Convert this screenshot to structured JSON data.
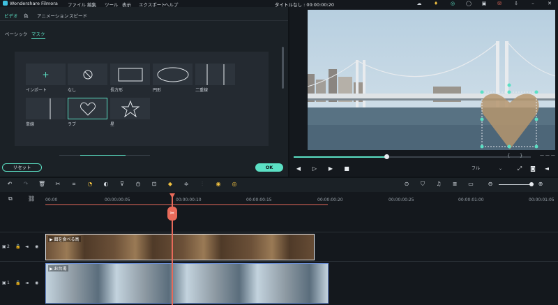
{
  "titlebar": {
    "app_name": "Wondershare Filmora",
    "menu": [
      "ファイル",
      "編集",
      "ツール",
      "表示",
      "エクスポート",
      "ヘルプ"
    ],
    "doc_title": "タイトルなし : 00:00:00:20"
  },
  "panel": {
    "tabs": [
      "ビデオ",
      "色",
      "アニメーション",
      "スピード"
    ],
    "subtabs": [
      "ベーシック",
      "マスク"
    ],
    "mask_items": [
      {
        "label": "インポート",
        "icon": "plus-icon"
      },
      {
        "label": "なし",
        "icon": "none-icon"
      },
      {
        "label": "長方形",
        "icon": "rectangle-icon"
      },
      {
        "label": "円形",
        "icon": "circle-icon"
      },
      {
        "label": "二重線",
        "icon": "double-line-icon"
      },
      {
        "label": "単線",
        "icon": "single-line-icon"
      },
      {
        "label": "ラブ",
        "icon": "heart-icon"
      },
      {
        "label": "星",
        "icon": "star-icon"
      }
    ],
    "reset_label": "リセット",
    "ok_label": "OK"
  },
  "preview": {
    "zoom_value": "フル",
    "progress": 0.39,
    "nav_prev": "{",
    "nav_next": "}"
  },
  "timeline": {
    "ruler": [
      "00:00",
      "00:00:00:05",
      "00:00:00:10",
      "00:00:00:15",
      "00:00:00:20",
      "00:00:00:25",
      "00:00:01:00",
      "00:00:01:05"
    ],
    "tracks": [
      {
        "number": "2",
        "clip_label": "餌を食べる鳥"
      },
      {
        "number": "1",
        "clip_label": "お台場"
      }
    ]
  },
  "colors": {
    "accent": "#5be0c4",
    "playhead": "#e86a5a",
    "clip_border": "#6b8fd6"
  }
}
